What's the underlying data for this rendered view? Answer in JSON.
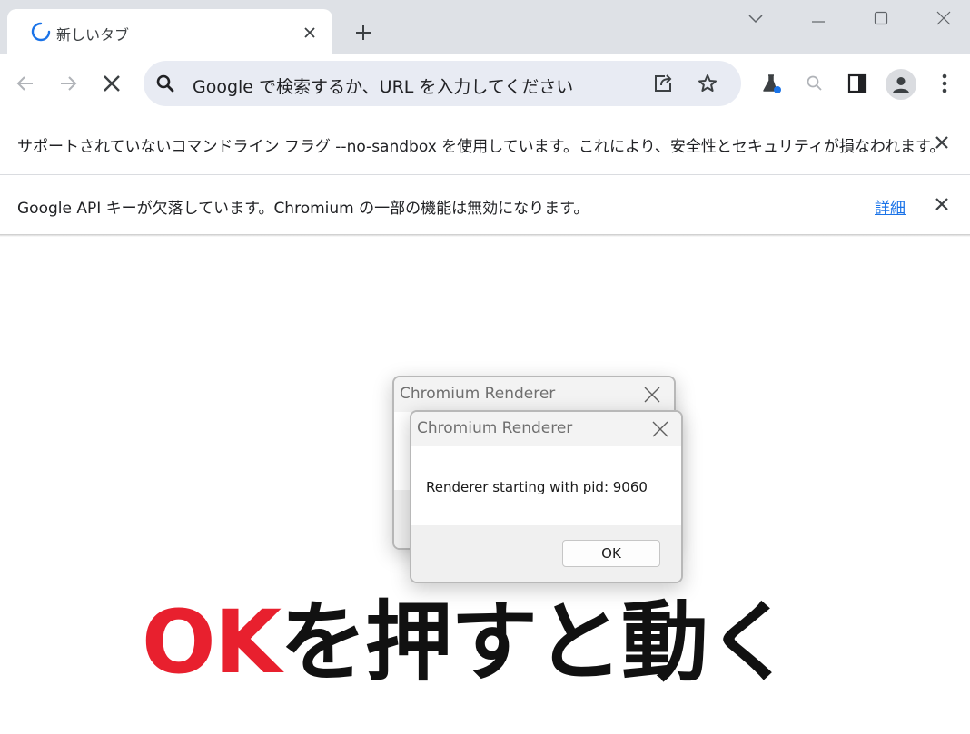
{
  "tab": {
    "title": "新しいタブ"
  },
  "omnibox": {
    "placeholder": "Google で検索するか、URL を入力してください"
  },
  "infobars": [
    {
      "text": "サポートされていないコマンドライン フラグ --no-sandbox を使用しています。これにより、安全性とセキュリティが損なわれます。"
    },
    {
      "text": "Google API キーが欠落しています。Chromium の一部の機能は無効になります。",
      "link": "詳細"
    }
  ],
  "dialog_back": {
    "title": "Chromium Renderer"
  },
  "dialog_front": {
    "title": "Chromium Renderer",
    "message": "Renderer starting with pid: 9060",
    "ok_label": "OK"
  },
  "caption": {
    "highlight": "OK",
    "rest": "を押すと動く"
  },
  "colors": {
    "accent": "#1a73e8",
    "caption_highlight": "#e8202e",
    "tabstrip": "#dee1e6",
    "omnibox": "#e8ebf3"
  }
}
